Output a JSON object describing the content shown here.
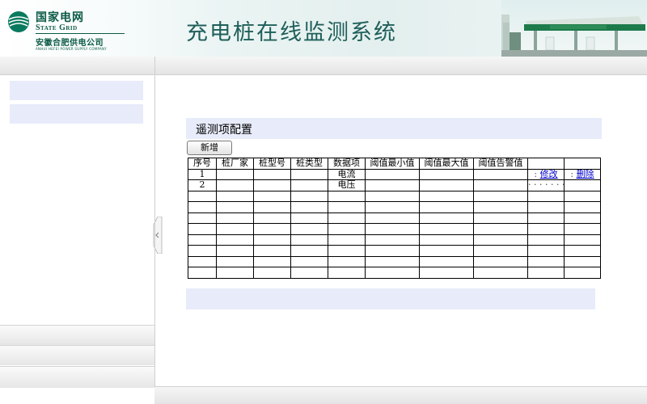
{
  "header": {
    "logo_cn": "国家电网",
    "logo_en": "State Grid",
    "logo_sub": "安徽合肥供电公司",
    "logo_sub_en": "ANHUI HEFEI POWER SUPPLY COMPANY",
    "system_title": "充电桩在线监测系统"
  },
  "section": {
    "title": "遥测项配置",
    "add_label": "新增"
  },
  "table": {
    "columns": [
      "序号",
      "桩厂家",
      "桩型号",
      "桩类型",
      "数据项",
      "阈值最小值",
      "阈值最大值",
      "阈值告警值",
      "",
      ""
    ],
    "rows": [
      {
        "index": "1",
        "item": "电流",
        "edit": "修改",
        "delete": "删除"
      },
      {
        "index": "2",
        "item": "电压"
      }
    ]
  },
  "colors": {
    "accent_panel": "#e8ebfa",
    "title_text": "#1f5f5a",
    "brand_green": "#0a5a45",
    "link": "#0000cc"
  }
}
